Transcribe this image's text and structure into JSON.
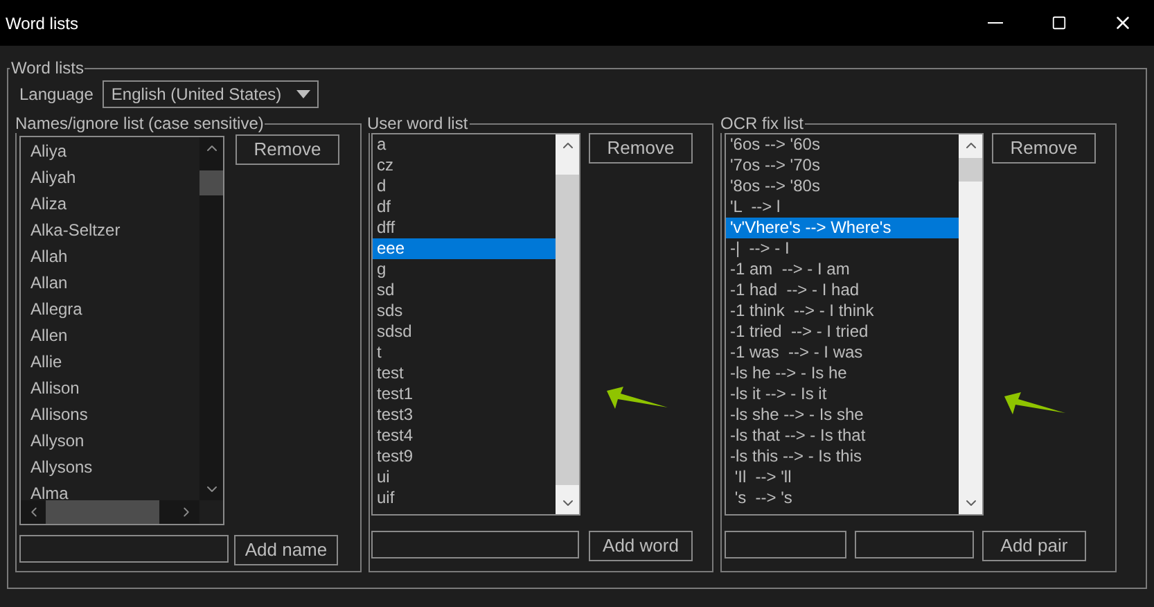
{
  "window": {
    "title": "Word lists"
  },
  "group": {
    "title": "Word lists",
    "language": {
      "label": "Language",
      "value": "English (United States)"
    }
  },
  "names_list": {
    "title": "Names/ignore list (case sensitive)",
    "remove_button": "Remove",
    "add_button": "Add name",
    "items": [
      {
        "text": "Aliya",
        "selected": false
      },
      {
        "text": "Aliyah",
        "selected": false
      },
      {
        "text": "Aliza",
        "selected": false
      },
      {
        "text": "Alka-Seltzer",
        "selected": false
      },
      {
        "text": "Allah",
        "selected": false
      },
      {
        "text": "Allan",
        "selected": false
      },
      {
        "text": "Allegra",
        "selected": false
      },
      {
        "text": "Allen",
        "selected": false
      },
      {
        "text": "Allie",
        "selected": false
      },
      {
        "text": "Allison",
        "selected": false
      },
      {
        "text": "Allisons",
        "selected": false
      },
      {
        "text": "Allyson",
        "selected": false
      },
      {
        "text": "Allysons",
        "selected": false
      },
      {
        "text": "Alma",
        "selected": false
      }
    ]
  },
  "user_list": {
    "title": "User word list",
    "remove_button": "Remove",
    "add_button": "Add word",
    "items": [
      {
        "text": "a",
        "selected": false
      },
      {
        "text": "cz",
        "selected": false
      },
      {
        "text": "d",
        "selected": false
      },
      {
        "text": "df",
        "selected": false
      },
      {
        "text": "dff",
        "selected": false
      },
      {
        "text": "eee",
        "selected": true
      },
      {
        "text": "g",
        "selected": false
      },
      {
        "text": "sd",
        "selected": false
      },
      {
        "text": "sds",
        "selected": false
      },
      {
        "text": "sdsd",
        "selected": false
      },
      {
        "text": "t",
        "selected": false
      },
      {
        "text": "test",
        "selected": false
      },
      {
        "text": "test1",
        "selected": false
      },
      {
        "text": "test3",
        "selected": false
      },
      {
        "text": "test4",
        "selected": false
      },
      {
        "text": "test9",
        "selected": false
      },
      {
        "text": "ui",
        "selected": false
      },
      {
        "text": "uif",
        "selected": false
      }
    ]
  },
  "ocr_list": {
    "title": "OCR fix list",
    "remove_button": "Remove",
    "add_button": "Add pair",
    "items": [
      {
        "text": "'6os --> '60s",
        "selected": false
      },
      {
        "text": "'7os --> '70s",
        "selected": false
      },
      {
        "text": "'8os --> '80s",
        "selected": false
      },
      {
        "text": "'L  --> l",
        "selected": false
      },
      {
        "text": "'v'Vhere's --> Where's",
        "selected": true
      },
      {
        "text": "-|  --> - I",
        "selected": false
      },
      {
        "text": "-1 am  --> - I am",
        "selected": false
      },
      {
        "text": "-1 had  --> - I had",
        "selected": false
      },
      {
        "text": "-1 think  --> - I think",
        "selected": false
      },
      {
        "text": "-1 tried  --> - I tried",
        "selected": false
      },
      {
        "text": "-1 was  --> - I was",
        "selected": false
      },
      {
        "text": "-ls he --> - Is he",
        "selected": false
      },
      {
        "text": "-ls it --> - Is it",
        "selected": false
      },
      {
        "text": "-ls she --> - Is she",
        "selected": false
      },
      {
        "text": "-ls that --> - Is that",
        "selected": false
      },
      {
        "text": "-ls this --> - Is this",
        "selected": false
      },
      {
        "text": " 'Il  --> 'll",
        "selected": false
      },
      {
        "text": " 's  --> 's",
        "selected": false
      }
    ]
  }
}
